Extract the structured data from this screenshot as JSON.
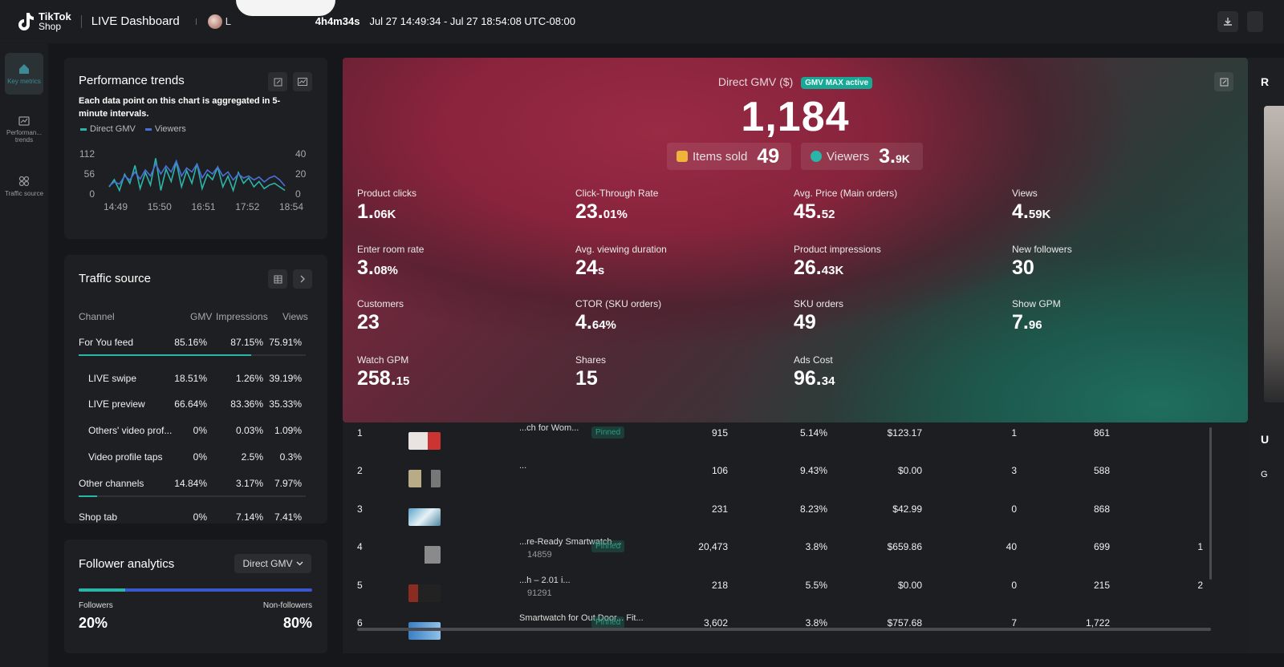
{
  "header": {
    "brand_line1": "TikTok",
    "brand_line2": "Shop",
    "title": "LIVE Dashboard",
    "host_initial": "L",
    "duration": "4h4m34s",
    "time_range": "Jul 27 14:49:34 - Jul 27 18:54:08 UTC-08:00",
    "download_icon": "download-icon"
  },
  "rail": {
    "items": [
      {
        "label": "Key metrics",
        "icon": "home-icon"
      },
      {
        "label": "Performan... trends",
        "icon": "chart-icon"
      },
      {
        "label": "Traffic source",
        "icon": "network-icon"
      }
    ]
  },
  "performance": {
    "title": "Performance trends",
    "description": "Each data point on this chart is aggregated in 5-minute intervals.",
    "legend_gmv": "Direct GMV",
    "legend_viewers": "Viewers",
    "gmv_color": "#2bb5a8",
    "viewers_color": "#4a6fd8"
  },
  "chart_data": {
    "type": "line",
    "x": [
      "14:49",
      "15:50",
      "16:51",
      "17:52",
      "18:54"
    ],
    "y_left_ticks": [
      "112",
      "56",
      "0"
    ],
    "y_right_ticks": [
      "40",
      "20",
      "0"
    ],
    "ylim_left": [
      0,
      112
    ],
    "ylim_right": [
      0,
      40
    ],
    "series": [
      {
        "name": "Direct GMV",
        "axis": "left",
        "values": [
          20,
          40,
          10,
          55,
          30,
          80,
          15,
          60,
          25,
          100,
          10,
          70,
          35,
          90,
          20,
          65,
          30,
          85,
          15,
          55,
          40,
          75,
          20,
          50,
          10,
          60,
          30,
          45,
          20,
          35,
          15,
          25,
          30,
          20,
          10
        ]
      },
      {
        "name": "Viewers",
        "axis": "right",
        "values": [
          8,
          12,
          10,
          18,
          14,
          22,
          15,
          24,
          18,
          30,
          20,
          28,
          22,
          33,
          18,
          26,
          22,
          30,
          16,
          24,
          20,
          27,
          18,
          22,
          14,
          20,
          16,
          18,
          14,
          17,
          12,
          16,
          18,
          14,
          8
        ]
      }
    ]
  },
  "traffic": {
    "title": "Traffic source",
    "headers": {
      "channel": "Channel",
      "gmv": "GMV",
      "impressions": "Impressions",
      "views": "Views"
    },
    "rows": [
      {
        "channel": "For You feed",
        "gmv": "85.16%",
        "impressions": "87.15%",
        "views": "75.91%",
        "bar": 0.76,
        "indent": false
      },
      {
        "channel": "LIVE swipe",
        "gmv": "18.51%",
        "impressions": "1.26%",
        "views": "39.19%",
        "indent": true
      },
      {
        "channel": "LIVE preview",
        "gmv": "66.64%",
        "impressions": "83.36%",
        "views": "35.33%",
        "indent": true
      },
      {
        "channel": "Others' video prof...",
        "gmv": "0%",
        "impressions": "0.03%",
        "views": "1.09%",
        "indent": true
      },
      {
        "channel": "Video profile taps",
        "gmv": "0%",
        "impressions": "2.5%",
        "views": "0.3%",
        "indent": true
      },
      {
        "channel": "Other channels",
        "gmv": "14.84%",
        "impressions": "3.17%",
        "views": "7.97%",
        "bar": 0.08,
        "indent": false
      },
      {
        "channel": "Shop tab",
        "gmv": "0%",
        "impressions": "7.14%",
        "views": "7.41%",
        "indent": false
      }
    ]
  },
  "follower": {
    "title": "Follower analytics",
    "dropdown": "Direct GMV",
    "followers_label": "Followers",
    "nonfollowers_label": "Non-followers",
    "followers_pct": "20%",
    "nonfollowers_pct": "80%",
    "followers_fraction": 0.2
  },
  "hero": {
    "gmv_label": "Direct GMV ($)",
    "gmv_badge": "GMV MAX active",
    "gmv_value": "1,184",
    "items_sold_label": "Items sold",
    "items_sold_value": "49",
    "viewers_label": "Viewers",
    "viewers_value": "3.",
    "viewers_suffix": "9K",
    "metrics": [
      {
        "label": "Product clicks",
        "main": "1.",
        "small": "06K"
      },
      {
        "label": "Click-Through Rate",
        "main": "23.",
        "small": "01%"
      },
      {
        "label": "Avg. Price (Main orders)",
        "main": "45.",
        "small": "52"
      },
      {
        "label": "Views",
        "main": "4.",
        "small": "59K"
      },
      {
        "label": "Enter room rate",
        "main": "3.",
        "small": "08%"
      },
      {
        "label": "Avg. viewing duration",
        "main": "24",
        "small": "s"
      },
      {
        "label": "Product impressions",
        "main": "26.",
        "small": "43K"
      },
      {
        "label": "New followers",
        "main": "30",
        "small": ""
      },
      {
        "label": "Customers",
        "main": "23",
        "small": ""
      },
      {
        "label": "CTOR (SKU orders)",
        "main": "4.",
        "small": "64%"
      },
      {
        "label": "SKU orders",
        "main": "49",
        "small": ""
      },
      {
        "label": "Show GPM",
        "main": "7.",
        "small": "96"
      },
      {
        "label": "Watch GPM",
        "main": "258.",
        "small": "15"
      },
      {
        "label": "Shares",
        "main": "15",
        "small": ""
      },
      {
        "label": "Ads Cost",
        "main": "96.",
        "small": "34"
      }
    ]
  },
  "products": {
    "pinned_label": "Pinned",
    "rows": [
      {
        "rank": "1",
        "name": "...ch for Wom...",
        "sub": "",
        "pinned": true,
        "c1": "915",
        "c2": "5.14%",
        "c3": "$123.17",
        "c4": "1",
        "c5": "861",
        "c6": ""
      },
      {
        "rank": "2",
        "name": "...",
        "sub": "",
        "pinned": false,
        "c1": "106",
        "c2": "9.43%",
        "c3": "$0.00",
        "c4": "3",
        "c5": "588",
        "c6": ""
      },
      {
        "rank": "3",
        "name": "",
        "sub": "",
        "pinned": false,
        "c1": "231",
        "c2": "8.23%",
        "c3": "$42.99",
        "c4": "0",
        "c5": "868",
        "c6": ""
      },
      {
        "rank": "4",
        "name": "...re-Ready Smartwatch ...",
        "sub": "14859",
        "pinned": true,
        "c1": "20,473",
        "c2": "3.8%",
        "c3": "$659.86",
        "c4": "40",
        "c5": "699",
        "c6": "1"
      },
      {
        "rank": "5",
        "name": "...h – 2.01 i...",
        "sub": "91291",
        "pinned": false,
        "c1": "218",
        "c2": "5.5%",
        "c3": "$0.00",
        "c4": "0",
        "c5": "215",
        "c6": "2"
      },
      {
        "rank": "6",
        "name": "Smartwatch for Out Door... Fit...",
        "sub": "",
        "pinned": true,
        "c1": "3,602",
        "c2": "3.8%",
        "c3": "$757.68",
        "c4": "7",
        "c5": "1,722",
        "c6": ""
      }
    ]
  },
  "right_strip": {
    "letter_top": "R",
    "letter_mid": "U",
    "letter_low": "G"
  }
}
